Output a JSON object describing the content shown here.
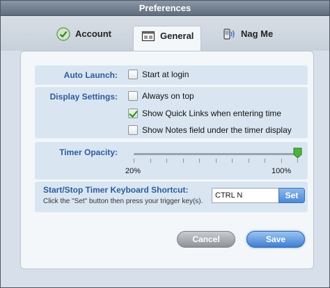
{
  "window": {
    "title": "Preferences"
  },
  "tabs": [
    {
      "label": "Account",
      "icon": "check-circle-icon"
    },
    {
      "label": "General",
      "icon": "window-icon",
      "selected": true
    },
    {
      "label": "Nag Me",
      "icon": "phone-signal-icon"
    }
  ],
  "auto_launch": {
    "label": "Auto Launch:",
    "options": [
      {
        "label": "Start at login",
        "checked": false
      }
    ]
  },
  "display_settings": {
    "label": "Display Settings:",
    "options": [
      {
        "label": "Always on top",
        "checked": false
      },
      {
        "label": "Show Quick Links when entering time",
        "checked": true
      },
      {
        "label": "Show Notes field under the timer display",
        "checked": false
      }
    ]
  },
  "timer_opacity": {
    "label": "Timer Opacity:",
    "min_label": "20%",
    "max_label": "100%",
    "value_fraction": 1.0
  },
  "shortcut": {
    "title": "Start/Stop Timer Keyboard Shortcut:",
    "hint": "Click the \"Set\" button then press your trigger key(s).",
    "value": "CTRL N",
    "set_label": "Set"
  },
  "buttons": {
    "cancel": "Cancel",
    "save": "Save"
  },
  "colors": {
    "label_blue": "#2e5a9c",
    "section_bg": "#d9e6f2",
    "accent": "#3f7fd4"
  }
}
